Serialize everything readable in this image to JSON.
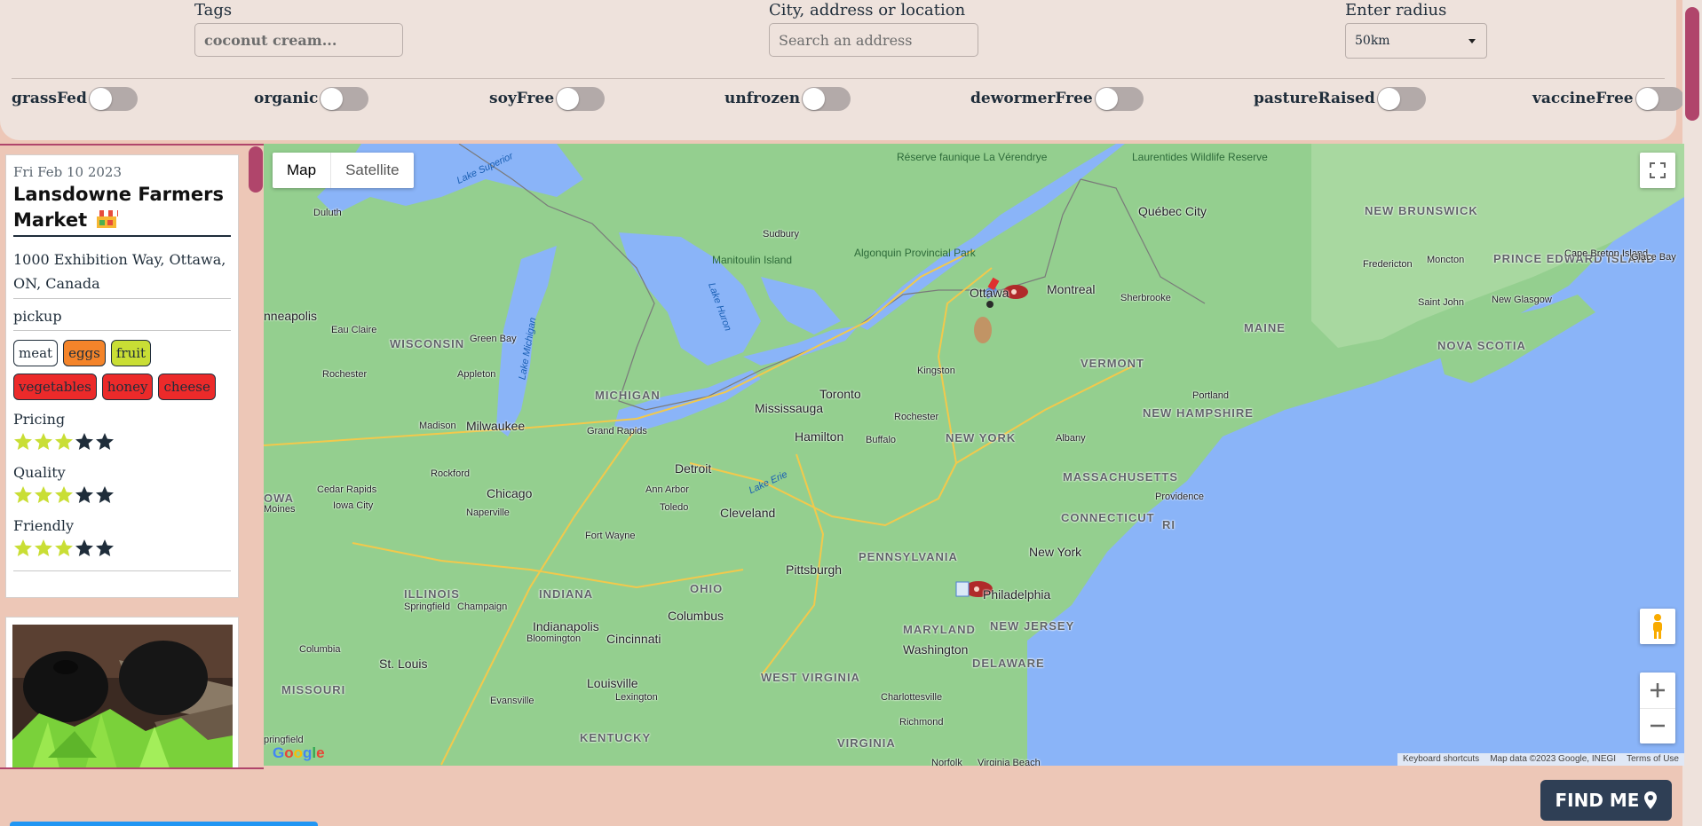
{
  "filters": {
    "tags_label": "Tags",
    "tags_placeholder": "coconut cream...",
    "location_label": "City, address or location",
    "location_placeholder": "Search an address",
    "radius_label": "Enter radius",
    "radius_value": "50km",
    "toggles": [
      {
        "label": "grassFed",
        "on": false
      },
      {
        "label": "organic",
        "on": false
      },
      {
        "label": "soyFree",
        "on": false
      },
      {
        "label": "unfrozen",
        "on": false
      },
      {
        "label": "dewormerFree",
        "on": false
      },
      {
        "label": "pastureRaised",
        "on": false
      },
      {
        "label": "vaccineFree",
        "on": false
      }
    ]
  },
  "listing": {
    "date": "Fri Feb 10 2023",
    "title": "Lansdowne Farmers Market",
    "icon": "market-stall-icon",
    "address": "1000 Exhibition Way, Ottawa, ON, Canada",
    "method": "pickup",
    "tags": [
      "meat",
      "eggs",
      "fruit",
      "vegetables",
      "honey",
      "cheese"
    ],
    "ratings": [
      {
        "label": "Pricing",
        "value": 3,
        "max": 5
      },
      {
        "label": "Quality",
        "value": 3,
        "max": 5
      },
      {
        "label": "Friendly",
        "value": 3,
        "max": 5
      }
    ],
    "colors": {
      "star_on": "#c9de35",
      "star_off": "#1f2d3a"
    }
  },
  "map": {
    "type_buttons": [
      "Map",
      "Satellite"
    ],
    "active_type": "Map",
    "labels": {
      "lake_superior": "Lake Superior",
      "reserve": "Réserve faunique La Vérendrye",
      "laurentides": "Laurentides Wildlife Reserve",
      "duluth": "Duluth",
      "sudbury": "Sudbury",
      "quebec_city": "Québec City",
      "new_brunswick": "NEW BRUNSWICK",
      "fredericton": "Fredericton",
      "moncton": "Moncton",
      "pei": "PRINCE EDWARD ISLAND",
      "cape_breton": "Cape Breton Island",
      "glace_bay": "Glace Bay",
      "algonquin": "Algonquin Provincial Park",
      "manitoulin": "Manitoulin Island",
      "ottawa": "Ottawa",
      "montreal": "Montreal",
      "sherbrooke": "Sherbrooke",
      "saint_john": "Saint John",
      "new_glasgow": "New Glasgow",
      "minneapolis": "nneapolis",
      "eau_claire": "Eau Claire",
      "wisconsin": "WISCONSIN",
      "green_bay": "Green Bay",
      "lake_michigan": "Lake Michigan",
      "lake_huron": "Lake Huron",
      "maine": "MAINE",
      "nova_scotia": "NOVA SCOTIA",
      "rochester_mn": "Rochester",
      "appleton": "Appleton",
      "michigan": "MICHIGAN",
      "kingston": "Kingston",
      "vermont": "VERMONT",
      "toronto": "Toronto",
      "mississauga": "Mississauga",
      "new_hampshire": "NEW HAMPSHIRE",
      "portland": "Portland",
      "madison": "Madison",
      "milwaukee": "Milwaukee",
      "grand_rapids": "Grand Rapids",
      "hamilton": "Hamilton",
      "rochester_ny": "Rochester",
      "buffalo": "Buffalo",
      "new_york_state": "NEW YORK",
      "albany": "Albany",
      "rockford": "Rockford",
      "detroit": "Detroit",
      "massachusetts": "MASSACHUSETTS",
      "iowa": "OWA",
      "cedar_rapids": "Cedar Rapids",
      "chicago": "Chicago",
      "ann_arbor": "Ann Arbor",
      "lake_erie": "Lake Erie",
      "moines": "Moines",
      "iowa_city": "Iowa City",
      "naperville": "Naperville",
      "toledo": "Toledo",
      "cleveland": "Cleveland",
      "connecticut": "CONNECTICUT",
      "providence": "Providence",
      "ri": "RI",
      "fort_wayne": "Fort Wayne",
      "new_york": "New York",
      "pittsburgh": "Pittsburgh",
      "pennsylvania": "PENNSYLVANIA",
      "ohio": "OHIO",
      "illinois": "ILLINOIS",
      "indiana": "INDIANA",
      "philadelphia": "Philadelphia",
      "springfield": "Springfield",
      "champaign": "Champaign",
      "columbus": "Columbus",
      "indianapolis": "Indianapolis",
      "bloomington": "Bloomington",
      "maryland": "MARYLAND",
      "new_jersey": "NEW JERSEY",
      "cincinnati": "Cincinnati",
      "columbia": "Columbia",
      "washington": "Washington",
      "st_louis": "St. Louis",
      "delaware": "DELAWARE",
      "west_virginia": "WEST VIRGINIA",
      "missouri": "MISSOURI",
      "louisville": "Louisville",
      "lexington": "Lexington",
      "charlottesville": "Charlottesville",
      "evansville": "Evansville",
      "richmond": "Richmond",
      "kentucky": "KENTUCKY",
      "virginia": "VIRGINIA",
      "springfield_mo": "pringfield",
      "norfolk": "Norfolk",
      "virginia_beach": "Virginia Beach"
    },
    "google": "Google",
    "footer": [
      "Keyboard shortcuts",
      "Map data ©2023 Google, INEGI",
      "Terms of Use"
    ]
  },
  "find_me": "FIND ME"
}
